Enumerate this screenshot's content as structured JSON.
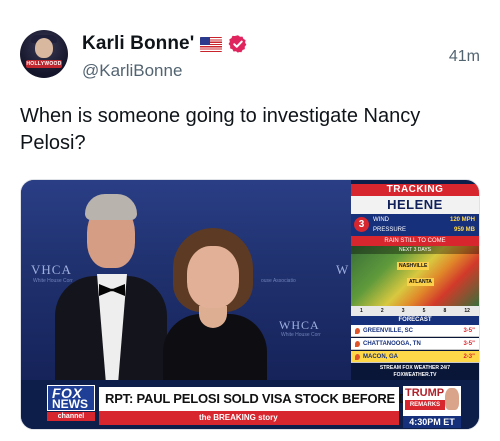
{
  "tweet": {
    "display_name": "Karli Bonne'",
    "handle": "@KarliBonne",
    "timestamp": "41m",
    "text": "When is someone going to investigate Nancy Pelosi?",
    "avatar_label": "HOLLYWOOD",
    "icons": [
      "us-flag-icon",
      "verified-badge-icon"
    ],
    "verified_color": "#e0245e"
  },
  "media": {
    "backdrop": [
      "VHCA",
      "WHCA",
      "W"
    ],
    "backdrop_sub": [
      "White House Corr",
      "White House Corr",
      "ouse Associatio"
    ],
    "weather": {
      "tracking": "TRACKING",
      "storm": "HELENE",
      "category": "3",
      "wind_label": "WIND",
      "wind_value": "120 MPH",
      "pressure_label": "PRESSURE",
      "pressure_value": "959 MB",
      "rain_banner": "RAIN STILL TO COME",
      "map_title": "NEXT 3 DAYS",
      "cities_map": [
        "NASHVILLE",
        "ATLANTA"
      ],
      "days": [
        "1",
        "2",
        "3",
        "5",
        "8",
        "12"
      ],
      "forecast_title": "FORECAST",
      "forecast": [
        {
          "city": "GREENVILLE, SC",
          "amount": "3-5\""
        },
        {
          "city": "CHATTANOOGA, TN",
          "amount": "3-5\""
        },
        {
          "city": "MACON, GA",
          "amount": "2-3\""
        }
      ],
      "stream_line1": "STREAM FOX WEATHER 24/7",
      "stream_line2": "FOXWEATHER.TV"
    },
    "chyron": {
      "logo_top": "FOX",
      "logo_bottom": "NEWS",
      "logo_channel": "channel",
      "headline": "RPT: PAUL PELOSI SOLD VISA STOCK BEFORE DOJ SUIT",
      "ticker": "the BREAKING story",
      "side_title": "TRUMP",
      "side_sub": "REMARKS",
      "clock": "4:30PM ET"
    }
  }
}
